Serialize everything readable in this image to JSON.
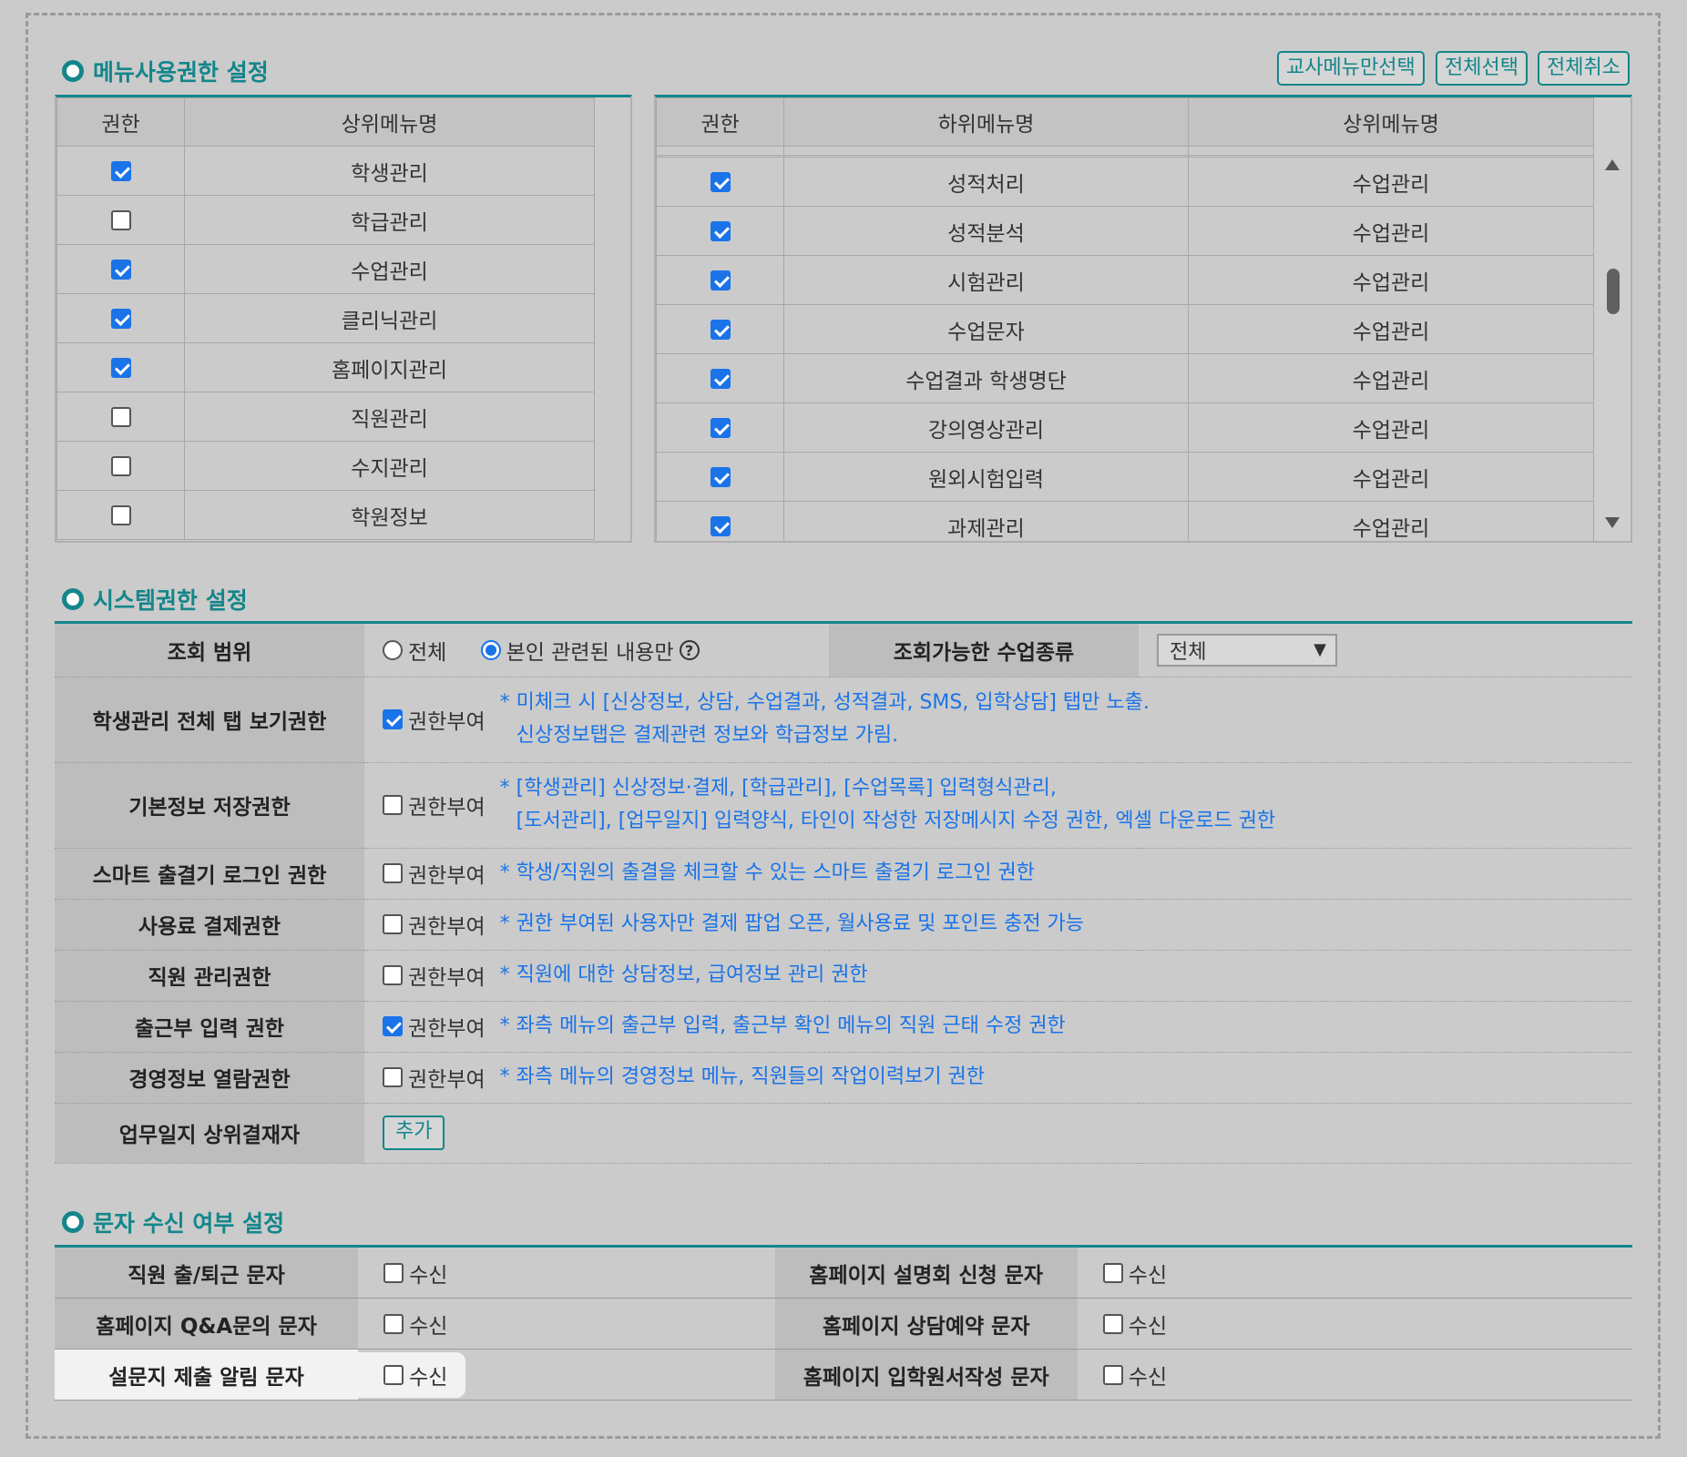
{
  "menu_section": {
    "title": "메뉴사용권한 설정",
    "buttons": {
      "teacher_only": "교사메뉴만선택",
      "select_all": "전체선택",
      "cancel_all": "전체취소"
    },
    "left_table": {
      "headers": [
        "권한",
        "상위메뉴명"
      ],
      "rows": [
        {
          "checked": true,
          "name": "학생관리"
        },
        {
          "checked": false,
          "name": "학급관리"
        },
        {
          "checked": true,
          "name": "수업관리"
        },
        {
          "checked": true,
          "name": "클리닉관리"
        },
        {
          "checked": true,
          "name": "홈페이지관리"
        },
        {
          "checked": false,
          "name": "직원관리"
        },
        {
          "checked": false,
          "name": "수지관리"
        },
        {
          "checked": false,
          "name": "학원정보"
        }
      ]
    },
    "right_table": {
      "headers": [
        "권한",
        "하위메뉴명",
        "상위메뉴명"
      ],
      "rows": [
        {
          "checked": true,
          "sub": "성적처리",
          "parent": "수업관리"
        },
        {
          "checked": true,
          "sub": "성적분석",
          "parent": "수업관리"
        },
        {
          "checked": true,
          "sub": "시험관리",
          "parent": "수업관리"
        },
        {
          "checked": true,
          "sub": "수업문자",
          "parent": "수업관리"
        },
        {
          "checked": true,
          "sub": "수업결과 학생명단",
          "parent": "수업관리"
        },
        {
          "checked": true,
          "sub": "강의영상관리",
          "parent": "수업관리"
        },
        {
          "checked": true,
          "sub": "원외시험입력",
          "parent": "수업관리"
        },
        {
          "checked": true,
          "sub": "과제관리",
          "parent": "수업관리"
        }
      ]
    }
  },
  "system_section": {
    "title": "시스템권한 설정",
    "scope": {
      "label": "조회 범위",
      "option_all": "전체",
      "option_self": "본인 관련된 내용만",
      "selected": "self",
      "help_icon": "question-circle-icon",
      "class_type_label": "조회가능한 수업종류",
      "class_type_value": "전체"
    },
    "grant_label": "권한부여",
    "rows": [
      {
        "label": "학생관리 전체 탭 보기권한",
        "checked": true,
        "note1": "* 미체크 시 [신상정보, 상담, 수업결과, 성적결과, SMS, 입학상담] 탭만 노출.",
        "note2": "신상정보탭은 결제관련 정보와 학급정보 가림."
      },
      {
        "label": "기본정보 저장권한",
        "checked": false,
        "note1": "* [학생관리] 신상정보·결제, [학급관리], [수업목록] 입력형식관리,",
        "note2": "[도서관리], [업무일지] 입력양식, 타인이 작성한 저장메시지 수정 권한, 엑셀 다운로드 권한"
      },
      {
        "label": "스마트 출결기 로그인 권한",
        "checked": false,
        "note1": "* 학생/직원의 출결을 체크할 수 있는 스마트 출결기 로그인 권한"
      },
      {
        "label": "사용료 결제권한",
        "checked": false,
        "note1": "* 권한 부여된 사용자만 결제 팝업 오픈, 월사용료 및 포인트 충전 가능"
      },
      {
        "label": "직원 관리권한",
        "checked": false,
        "note1": "* 직원에 대한 상담정보, 급여정보 관리 권한"
      },
      {
        "label": "출근부 입력 권한",
        "checked": true,
        "note1": "* 좌측 메뉴의 출근부 입력, 출근부 확인 메뉴의 직원 근태 수정 권한"
      },
      {
        "label": "경영정보 열람권한",
        "checked": false,
        "note1": "* 좌측 메뉴의 경영정보 메뉴, 직원들의 작업이력보기 권한"
      }
    ],
    "approver": {
      "label": "업무일지 상위결재자",
      "button": "추가"
    }
  },
  "sms_section": {
    "title": "문자 수신 여부 설정",
    "receive_label": "수신",
    "rows": [
      [
        {
          "label": "직원 출/퇴근 문자",
          "checked": false
        },
        {
          "label": "홈페이지 설명회 신청 문자",
          "checked": false
        }
      ],
      [
        {
          "label": "홈페이지 Q&A문의 문자",
          "checked": false
        },
        {
          "label": "홈페이지 상담예약 문자",
          "checked": false
        }
      ],
      [
        {
          "label": "설문지 제출 알림 문자",
          "checked": false
        },
        {
          "label": "홈페이지 입학원서작성 문자",
          "checked": false
        }
      ]
    ]
  },
  "colors": {
    "accent": "#13868a",
    "note": "#1a73e8",
    "checkbox_on": "#1a73e8"
  }
}
